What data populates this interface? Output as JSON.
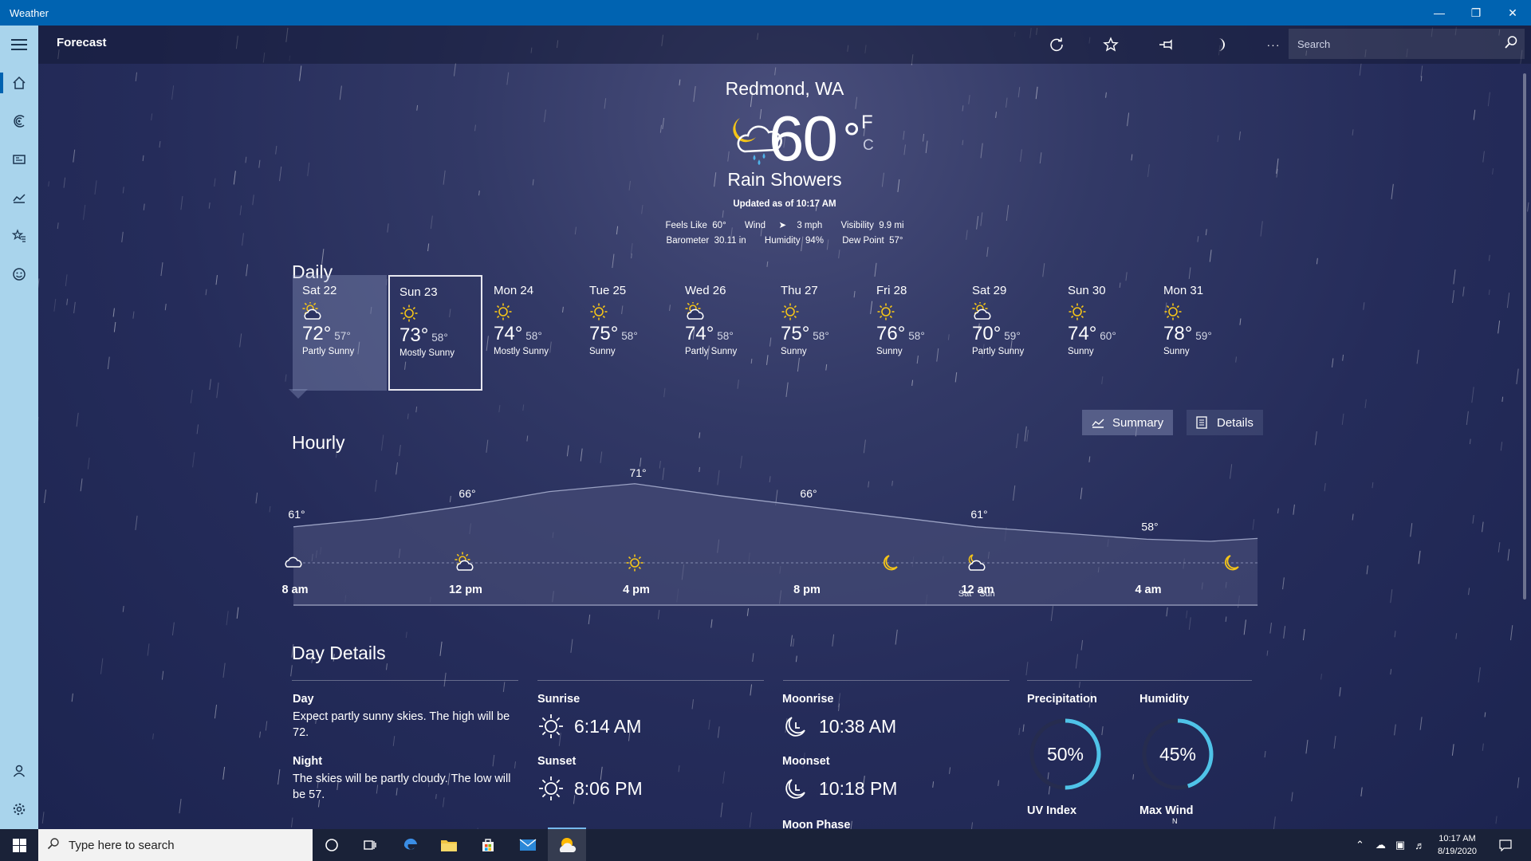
{
  "window": {
    "title": "Weather",
    "minimize_icon": "minimize-icon",
    "restore_icon": "restore-icon",
    "close_icon": "close-icon"
  },
  "sidebar": {
    "items": [
      "menu-icon",
      "home-icon",
      "radar-icon",
      "news-icon",
      "historical-icon",
      "favorites-icon",
      "feedback-icon",
      "account-icon",
      "settings-icon"
    ]
  },
  "header": {
    "title": "Forecast",
    "tools": [
      "refresh-icon",
      "favorite-star-icon",
      "pin-icon",
      "moon-icon",
      "more-icon"
    ],
    "more_label": "···",
    "search_placeholder": "Search"
  },
  "current": {
    "location": "Redmond, WA",
    "temperature": "60",
    "degree": "°",
    "unit_f": "F",
    "unit_c": "C",
    "condition": "Rain Showers",
    "updated": "Updated as of 10:17 AM",
    "feels_like_label": "Feels Like",
    "feels_like": "60°",
    "wind_label": "Wind",
    "wind": "3 mph",
    "visibility_label": "Visibility",
    "visibility": "9.9 mi",
    "barometer_label": "Barometer",
    "barometer": "30.11 in",
    "humidity_label": "Humidity",
    "humidity": "94%",
    "dew_point_label": "Dew Point",
    "dew_point": "57°"
  },
  "daily": {
    "title": "Daily",
    "days": [
      {
        "name": "Sat 22",
        "high": "72°",
        "low": "57°",
        "desc": "Partly Sunny",
        "icon": "partly-sunny-icon"
      },
      {
        "name": "Sun 23",
        "high": "73°",
        "low": "58°",
        "desc": "Mostly Sunny",
        "icon": "sun-icon"
      },
      {
        "name": "Mon 24",
        "high": "74°",
        "low": "58°",
        "desc": "Mostly Sunny",
        "icon": "sun-icon"
      },
      {
        "name": "Tue 25",
        "high": "75°",
        "low": "58°",
        "desc": "Sunny",
        "icon": "sun-icon"
      },
      {
        "name": "Wed 26",
        "high": "74°",
        "low": "58°",
        "desc": "Partly Sunny",
        "icon": "partly-sunny-icon"
      },
      {
        "name": "Thu 27",
        "high": "75°",
        "low": "58°",
        "desc": "Sunny",
        "icon": "sun-icon"
      },
      {
        "name": "Fri 28",
        "high": "76°",
        "low": "58°",
        "desc": "Sunny",
        "icon": "sun-icon"
      },
      {
        "name": "Sat 29",
        "high": "70°",
        "low": "59°",
        "desc": "Partly Sunny",
        "icon": "partly-sunny-icon"
      },
      {
        "name": "Sun 30",
        "high": "74°",
        "low": "60°",
        "desc": "Sunny",
        "icon": "sun-icon"
      },
      {
        "name": "Mon 31",
        "high": "78°",
        "low": "59°",
        "desc": "Sunny",
        "icon": "sun-icon"
      }
    ]
  },
  "hourly": {
    "title": "Hourly",
    "summary_label": "Summary",
    "details_label": "Details",
    "temps": [
      {
        "label": "61°",
        "hour": 0
      },
      {
        "label": "66°",
        "hour": 4
      },
      {
        "label": "71°",
        "hour": 8
      },
      {
        "label": "66°",
        "hour": 12
      },
      {
        "label": "61°",
        "hour": 16
      },
      {
        "label": "58°",
        "hour": 20
      }
    ],
    "times": [
      "8 am",
      "12 pm",
      "4 pm",
      "8 pm",
      "12 am",
      "4 am"
    ],
    "day_labels": [
      "Sat",
      "Sun"
    ],
    "icons": [
      "cloud-icon",
      "partly-sunny-icon",
      "sun-icon",
      "moon-icon",
      "partly-cloudy-night-icon",
      "moon-icon"
    ]
  },
  "day_details": {
    "title": "Day Details",
    "day_label": "Day",
    "day_text": "Expect partly sunny skies. The high will be 72.",
    "night_label": "Night",
    "night_text": "The skies will be partly cloudy. The low will be 57.",
    "sunrise_label": "Sunrise",
    "sunrise": "6:14 AM",
    "sunset_label": "Sunset",
    "sunset": "8:06 PM",
    "moonrise_label": "Moonrise",
    "moonrise": "10:38 AM",
    "moonset_label": "Moonset",
    "moonset": "10:18 PM",
    "moon_phase_label": "Moon Phase",
    "precip_label": "Precipitation",
    "precip": "50%",
    "precip_value": 50,
    "humidity_label": "Humidity",
    "humidity": "45%",
    "humidity_value": 45,
    "uv_label": "UV Index",
    "wind_label": "Max Wind",
    "wind_dir": "N"
  },
  "taskbar": {
    "search_placeholder": "Type here to search",
    "time": "10:17 AM",
    "date": "8/19/2020",
    "apps": [
      "cortana-icon",
      "task-view-icon",
      "edge-icon",
      "file-explorer-icon",
      "store-icon",
      "mail-icon",
      "weather-app-icon"
    ]
  },
  "colors": {
    "accent": "#0063b1",
    "sidebar": "#a9d4ec",
    "ring": "#4fc3e8",
    "sun": "#f5c518"
  }
}
